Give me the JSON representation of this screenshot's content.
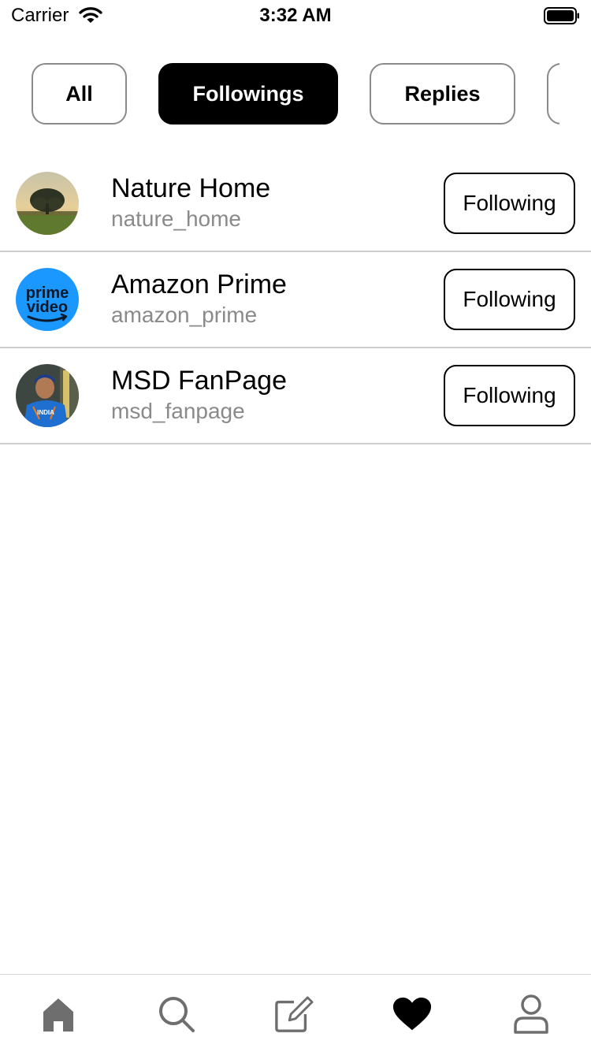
{
  "status_bar": {
    "carrier": "Carrier",
    "time": "3:32 AM"
  },
  "filters": [
    {
      "label": "All",
      "active": false
    },
    {
      "label": "Followings",
      "active": true
    },
    {
      "label": "Replies",
      "active": false
    }
  ],
  "accounts": [
    {
      "name": "Nature Home",
      "handle": "nature_home",
      "button": "Following"
    },
    {
      "name": "Amazon Prime",
      "handle": "amazon_prime",
      "button": "Following",
      "logo_text": [
        "prime",
        "video"
      ]
    },
    {
      "name": "MSD FanPage",
      "handle": "msd_fanpage",
      "button": "Following",
      "jersey_text": "INDIA"
    }
  ],
  "tabbar": {
    "items": [
      {
        "icon": "home-icon",
        "active": false
      },
      {
        "icon": "search-icon",
        "active": false
      },
      {
        "icon": "compose-icon",
        "active": false
      },
      {
        "icon": "heart-icon",
        "active": true
      },
      {
        "icon": "profile-icon",
        "active": false
      }
    ]
  },
  "colors": {
    "accent": "#000000",
    "inactive_icon": "#6e6e6e",
    "secondary_text": "#8a8a8a",
    "prime_blue": "#1a98ff"
  }
}
